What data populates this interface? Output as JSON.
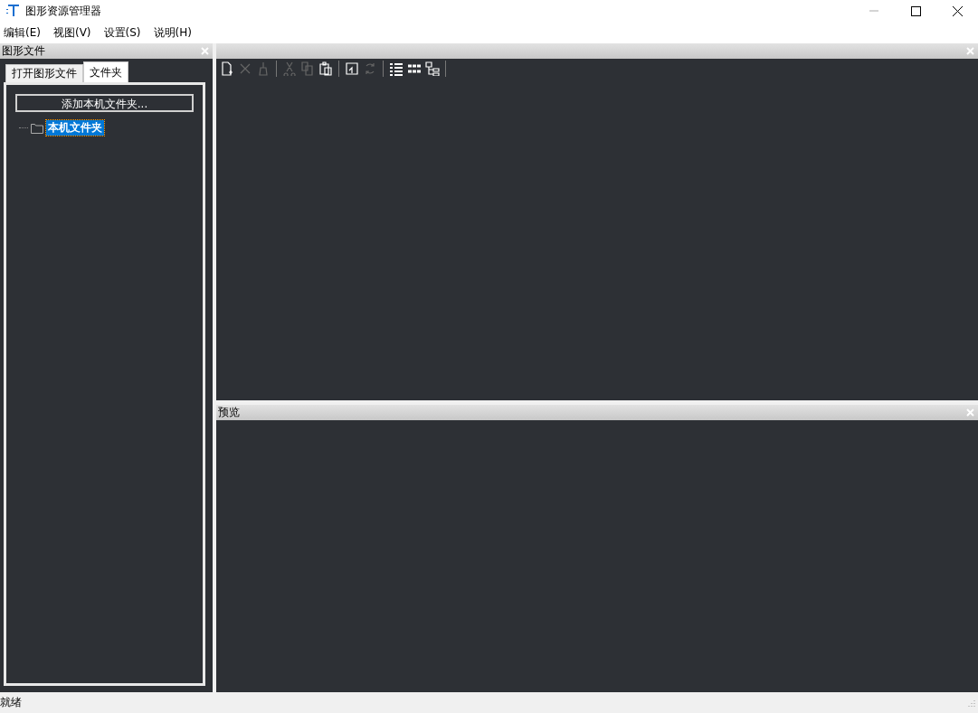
{
  "window": {
    "title": "图形资源管理器"
  },
  "menu": [
    {
      "label": "编辑(E)"
    },
    {
      "label": "视图(V)"
    },
    {
      "label": "设置(S)"
    },
    {
      "label": "说明(H)"
    }
  ],
  "left_panel": {
    "title": "图形文件",
    "tabs": [
      {
        "label": "打开图形文件",
        "selected": false
      },
      {
        "label": "文件夹",
        "selected": true
      }
    ],
    "add_button": "添加本机文件夹...",
    "tree": [
      {
        "label": "本机文件夹",
        "selected": true
      }
    ]
  },
  "toolbar": [
    {
      "kind": "new",
      "disabled": false
    },
    {
      "kind": "delete",
      "disabled": true
    },
    {
      "kind": "clean",
      "disabled": true
    },
    {
      "kind": "sep"
    },
    {
      "kind": "cut",
      "disabled": true
    },
    {
      "kind": "copy",
      "disabled": true
    },
    {
      "kind": "paste",
      "disabled": false
    },
    {
      "kind": "sep"
    },
    {
      "kind": "insert",
      "disabled": false
    },
    {
      "kind": "refresh",
      "disabled": true
    },
    {
      "kind": "sep"
    },
    {
      "kind": "list",
      "disabled": false
    },
    {
      "kind": "icons",
      "disabled": false
    },
    {
      "kind": "tree",
      "disabled": false
    },
    {
      "kind": "sep"
    }
  ],
  "preview_panel": {
    "title": "预览"
  },
  "status_bar": "就绪"
}
